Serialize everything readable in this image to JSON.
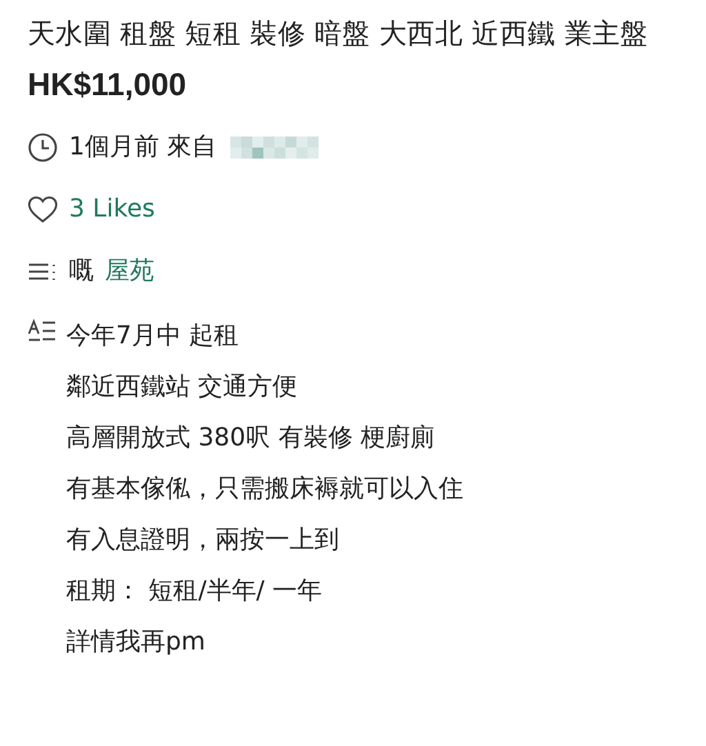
{
  "title": "天水圍 租盤 短租 裝修 暗盤 大西北 近西鐵 業主盤",
  "price": "HK$11,000",
  "posted": {
    "text": "1個月前 來自"
  },
  "likes": {
    "text": "3 Likes"
  },
  "category": {
    "prefix": "嘅",
    "link": "屋苑"
  },
  "description": [
    "今年7月中 起租",
    "鄰近西鐵站 交通方便",
    "高層開放式 380呎 有裝修 梗廚廁",
    "有基本傢俬，只需搬床褥就可以入住",
    "有入息證明，兩按一上到",
    "租期： 短租/半年/ 一年",
    "詳情我再pm"
  ]
}
